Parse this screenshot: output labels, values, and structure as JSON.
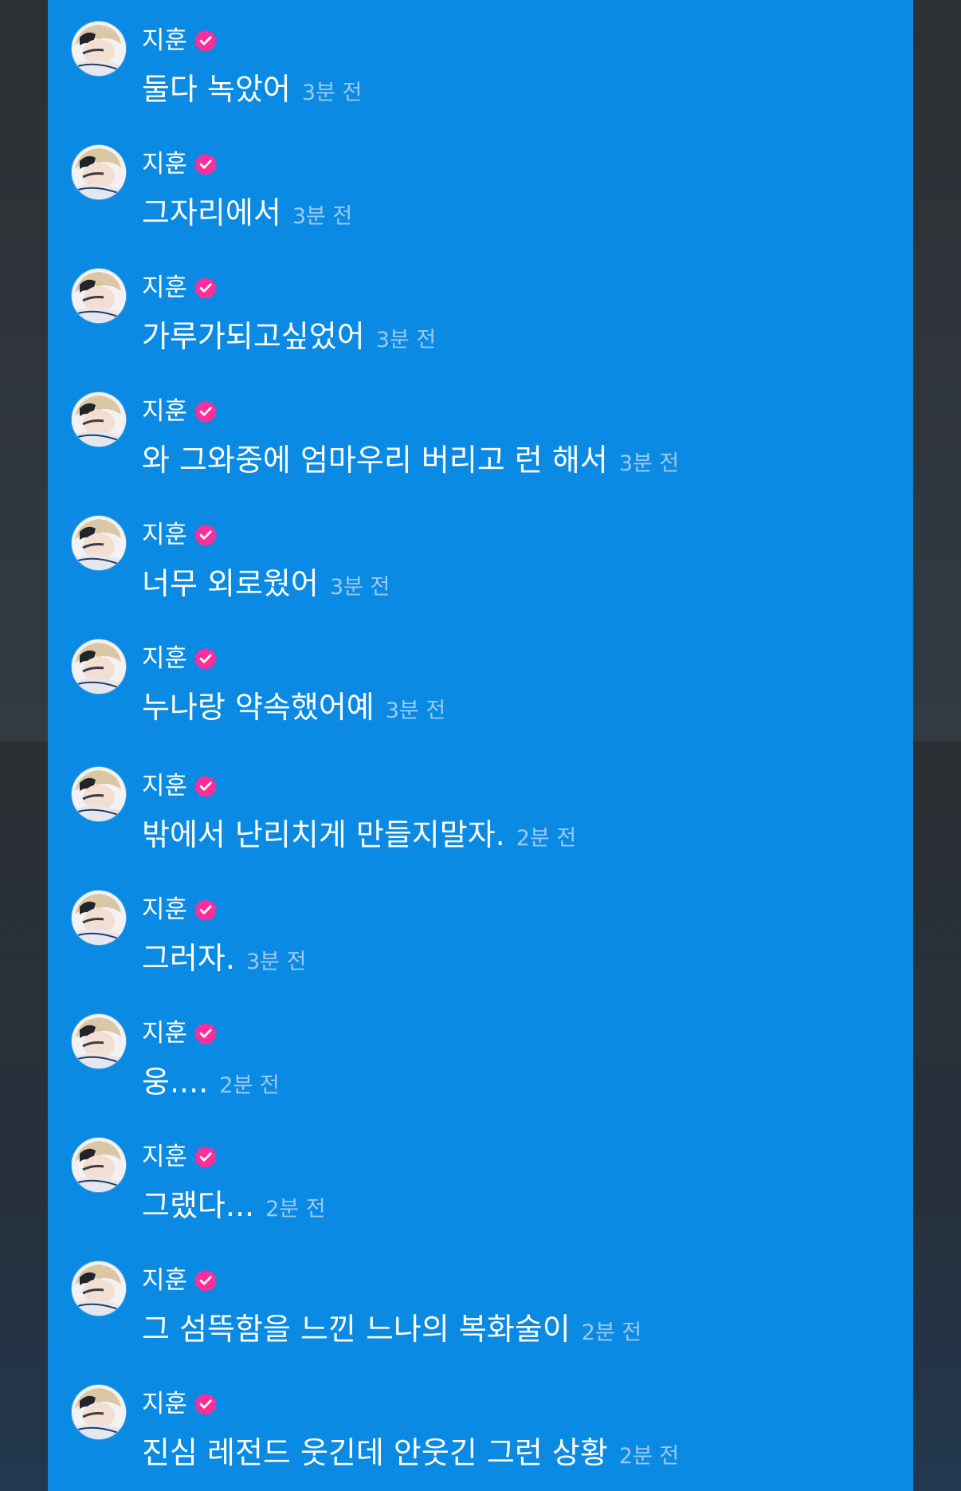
{
  "colors": {
    "panel_background": "#0a8ae3",
    "text_primary": "#ffffff",
    "timestamp": "#9cc9f0",
    "verified_badge": "#ff2d9a"
  },
  "messages": [
    {
      "sender": "지훈",
      "text": "둘다 녹았어",
      "time": "3분 전",
      "avatar_icon": "profile-photo",
      "badge_icon": "verified-check-icon"
    },
    {
      "sender": "지훈",
      "text": "그자리에서",
      "time": "3분 전",
      "avatar_icon": "profile-photo",
      "badge_icon": "verified-check-icon"
    },
    {
      "sender": "지훈",
      "text": "가루가되고싶었어",
      "time": "3분 전",
      "avatar_icon": "profile-photo",
      "badge_icon": "verified-check-icon"
    },
    {
      "sender": "지훈",
      "text": "와 그와중에 엄마우리 버리고 런 해서",
      "time": "3분 전",
      "avatar_icon": "profile-photo",
      "badge_icon": "verified-check-icon"
    },
    {
      "sender": "지훈",
      "text": "너무 외로웠어",
      "time": "3분 전",
      "avatar_icon": "profile-photo",
      "badge_icon": "verified-check-icon"
    },
    {
      "sender": "지훈",
      "text": "누나랑 약속했어예",
      "time": "3분 전",
      "avatar_icon": "profile-photo",
      "badge_icon": "verified-check-icon"
    },
    {
      "sender": "지훈",
      "text": "밖에서 난리치게 만들지말자.",
      "time": "2분 전",
      "avatar_icon": "profile-photo",
      "badge_icon": "verified-check-icon"
    },
    {
      "sender": "지훈",
      "text": "그러자.",
      "time": "3분 전",
      "avatar_icon": "profile-photo",
      "badge_icon": "verified-check-icon"
    },
    {
      "sender": "지훈",
      "text": "웅....",
      "time": "2분 전",
      "avatar_icon": "profile-photo",
      "badge_icon": "verified-check-icon"
    },
    {
      "sender": "지훈",
      "text": "그랬다...",
      "time": "2분 전",
      "avatar_icon": "profile-photo",
      "badge_icon": "verified-check-icon"
    },
    {
      "sender": "지훈",
      "text": "그 섬뜩함을 느낀 느나의 복화술이",
      "time": "2분 전",
      "avatar_icon": "profile-photo",
      "badge_icon": "verified-check-icon"
    },
    {
      "sender": "지훈",
      "text": "진심 레전드 웃긴데 안웃긴 그런 상황",
      "time": "2분 전",
      "avatar_icon": "profile-photo",
      "badge_icon": "verified-check-icon"
    }
  ]
}
